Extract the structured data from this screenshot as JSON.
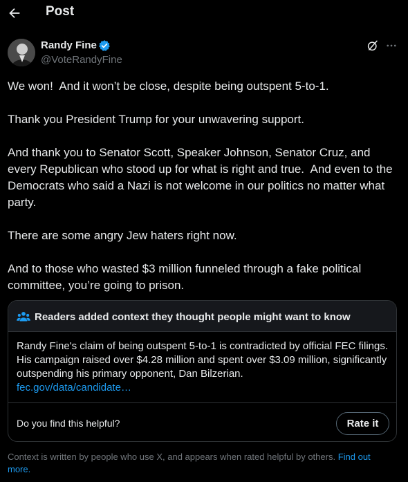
{
  "header": {
    "title": "Post",
    "back_icon": "arrow-left-icon"
  },
  "author": {
    "name": "Randy Fine",
    "handle": "@VoteRandyFine",
    "verified_icon": "verified-badge-icon",
    "verified_color": "#1d9bf0"
  },
  "actions": {
    "grok_icon": "grok-icon",
    "more_icon": "more-icon"
  },
  "tweet": {
    "paragraphs": [
      "We won!  And it won’t be close, despite being outspent 5-to-1.",
      "Thank you President Trump for your unwavering support.",
      "And thank you to Senator Scott, Speaker Johnson, Senator Cruz, and every Republican who stood up for what is right and true.  And even to the Democrats who said a Nazi is not welcome in our politics no matter what party.",
      "There are some angry Jew haters right now.",
      "And to those who wasted $3 million funneled through a fake political committee, you’re going to prison."
    ]
  },
  "community_note": {
    "title": "Readers added context they thought people might want to know",
    "body": "Randy Fine's claim of being outspent 5-to-1 is contradicted by official FEC filings. His campaign raised over $4.28 million and spent over $3.09 million, significantly outspending his primary opponent, Dan Bilzerian.",
    "link": "fec.gov/data/candidate…",
    "helpful_question": "Do you find this helpful?",
    "rate_label": "Rate it"
  },
  "footer": {
    "text": "Context is written by people who use X, and appears when rated helpful by others. ",
    "link": "Find out more."
  },
  "colors": {
    "background": "#000000",
    "text": "#e7e9ea",
    "muted": "#71767b",
    "accent": "#1d9bf0",
    "border": "#2f3336"
  }
}
